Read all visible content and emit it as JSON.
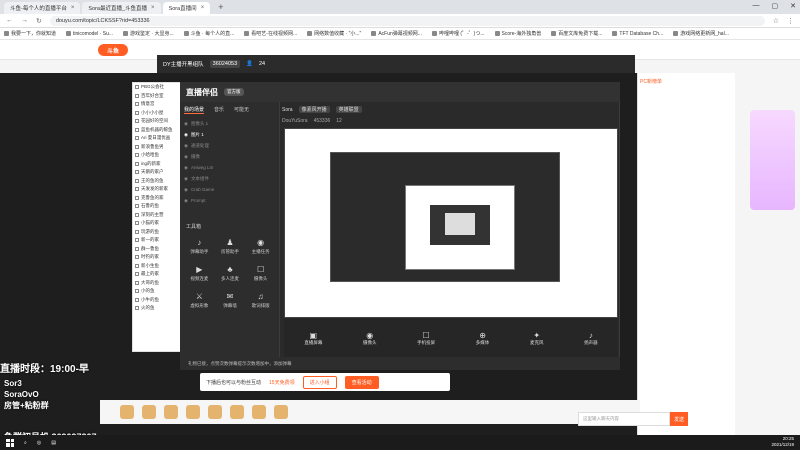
{
  "browser": {
    "tabs": [
      {
        "label": "斗鱼-每个人的直播平台",
        "active": false
      },
      {
        "label": "Sora最近直播_斗鱼直播",
        "active": false
      },
      {
        "label": "Sora直播间",
        "active": true
      }
    ],
    "new_tab": "+",
    "window_controls": [
      "—",
      "▢",
      "✕"
    ],
    "url": "douyu.com/topic/LCKSSF?rid=453336",
    "bookmarks": [
      "我要一下，你就知道",
      "tinicomodel · Su...",
      "游戏鉴定 · 大显身...",
      "斗鱼 · 每个人的直...",
      "看吧艺-在线视频网...",
      "网络数值收藏 · \"小...\"",
      "AcFun弹幕视频网...",
      "哔哩哔哩 (゜-゜)つ...",
      "Score-海外独角兽",
      "百度文库免费下载...",
      "TFT Database Ch...",
      "游戏网络更新网_hal..."
    ]
  },
  "site": {
    "logo_text": "斗鱼"
  },
  "player_bar": {
    "room_title": "DY主播开黑组队",
    "room_id": "36024053",
    "viewers": "24"
  },
  "room_list": {
    "items": [
      "PBG公会社",
      "百年好合室",
      "情意宫",
      "小小小小屋",
      "花园好的空间",
      "蓝鱼机器的鲸鱼",
      "Ari 夏日漫优画",
      "新浪鲁鱼男",
      "小哈哈鱼",
      "ing的新家",
      "天鹅的家户",
      "王的鱼的鱼",
      "天发发的新家",
      "克鲁鱼的家",
      "石鲁的鱼",
      "深刻的主营",
      "小猫的家",
      "玩游的鱼",
      "新一的家",
      "群一鲁鱼",
      "时钓的家",
      "新小生鱼",
      "最上的家",
      "大哥的鱼",
      "小的鱼",
      "小牛的鱼",
      "火的鱼"
    ]
  },
  "obs": {
    "logo": "直播伴侣",
    "version": "官方版",
    "tabs": [
      "我的场景",
      "音乐",
      "可能无"
    ],
    "scenes": [
      "图像头 1",
      "图片 1",
      "通道处理",
      "摄像",
      "Aniweg Ltn",
      "文本组件",
      "Crab Game",
      "Prompt"
    ],
    "tools_label": "工具箱",
    "tools": [
      {
        "icon": "♪",
        "label": "弹幕助手"
      },
      {
        "icon": "♟",
        "label": "房管助手"
      },
      {
        "icon": "◉",
        "label": "主播任务"
      },
      {
        "icon": "▶",
        "label": "视频连麦"
      },
      {
        "icon": "♣",
        "label": "多人连麦"
      },
      {
        "icon": "☐",
        "label": "摄像头"
      },
      {
        "icon": "⚔",
        "label": "虚拟形象"
      },
      {
        "icon": "✉",
        "label": "弹幕墙"
      },
      {
        "icon": "♫",
        "label": "歌词排版"
      }
    ],
    "info": {
      "name_label": "Sora",
      "tag": "像素风开播",
      "category": "英雄联盟",
      "channel": "DouYuSora",
      "room_id": "453336",
      "fans": "12"
    },
    "bottom_buttons": [
      {
        "icon": "▣",
        "label": "直播屏幕"
      },
      {
        "icon": "◉",
        "label": "摄像头"
      },
      {
        "icon": "☐",
        "label": "手机投屏"
      },
      {
        "icon": "⊕",
        "label": "多媒体"
      },
      {
        "icon": "✦",
        "label": "麦克风"
      },
      {
        "icon": "♪",
        "label": "扬声器"
      }
    ],
    "status": "礼物已接，点赞次数弹幕提示次数增加中，添加弹幕"
  },
  "ad": {
    "text": "下播后也可以与粉丝互动",
    "link": "15天免费领",
    "btn1": "进入小组",
    "btn2": "查看活动"
  },
  "overlay": {
    "live_time": "直播时段：19:00-早",
    "ids": [
      "Sor3",
      "SoraOvO",
      "房管+粘粉群"
    ],
    "qq": "鱼群初号机 369097207"
  },
  "chat": {
    "rank_tab": "PC新榜单",
    "input_placeholder": "这里输入聊天内容",
    "send": "发送"
  },
  "taskbar": {
    "time": "20:25",
    "date": "2021/12/19"
  }
}
